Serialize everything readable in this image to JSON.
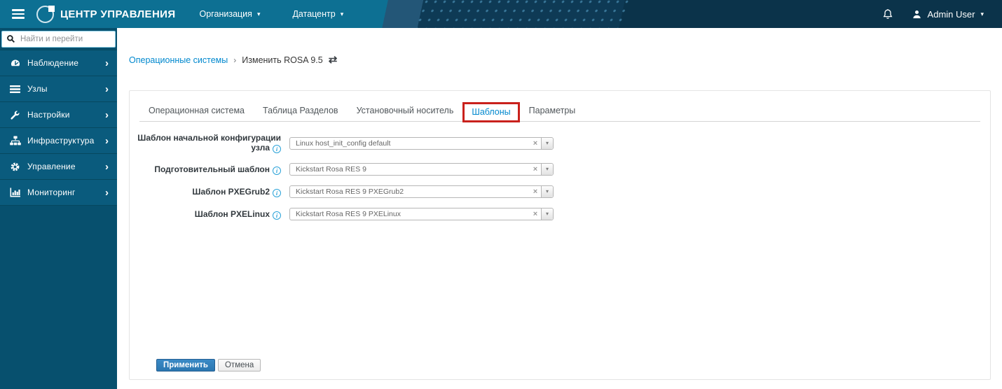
{
  "navbar": {
    "brand": "ЦЕНТР УПРАВЛЕНИЯ",
    "menus": [
      {
        "label": "Организация"
      },
      {
        "label": "Датацентр"
      }
    ],
    "user": {
      "name": "Admin User"
    }
  },
  "sidebar": {
    "search_placeholder": "Найти и перейти",
    "items": [
      {
        "label": "Наблюдение",
        "icon": "gauge-icon"
      },
      {
        "label": "Узлы",
        "icon": "list-icon"
      },
      {
        "label": "Настройки",
        "icon": "wrench-icon"
      },
      {
        "label": "Инфраструктура",
        "icon": "sitemap-icon"
      },
      {
        "label": "Управление",
        "icon": "gear-icon"
      },
      {
        "label": "Мониторинг",
        "icon": "chart-icon"
      }
    ]
  },
  "breadcrumb": {
    "link": "Операционные системы",
    "separator": "›",
    "current": "Изменить ROSA 9.5",
    "swap_icon": "⇄"
  },
  "tabs": [
    {
      "label": "Операционная система",
      "active": false
    },
    {
      "label": "Таблица Разделов",
      "active": false
    },
    {
      "label": "Установочный носитель",
      "active": false
    },
    {
      "label": "Шаблоны",
      "active": true,
      "highlighted": true
    },
    {
      "label": "Параметры",
      "active": false
    }
  ],
  "form": {
    "fields": [
      {
        "label": "Шаблон начальной конфигурации узла",
        "value": "Linux host_init_config default"
      },
      {
        "label": "Подготовительный шаблон",
        "value": "Kickstart Rosa RES 9"
      },
      {
        "label": "Шаблон PXEGrub2",
        "value": "Kickstart Rosa RES 9 PXEGrub2"
      },
      {
        "label": "Шаблон PXELinux",
        "value": "Kickstart Rosa RES 9 PXELinux"
      }
    ],
    "submit_label": "Применить",
    "cancel_label": "Отмена"
  },
  "icons": {
    "clear": "×",
    "caret_down": "▾",
    "chevron_right": "›",
    "info": "i"
  },
  "colors": {
    "accent": "#0088ce",
    "annotation_red": "#c9211c",
    "navbar_teal": "#0d7093",
    "navbar_dark": "#0b334a",
    "sidebar": "#0a5b7d"
  }
}
